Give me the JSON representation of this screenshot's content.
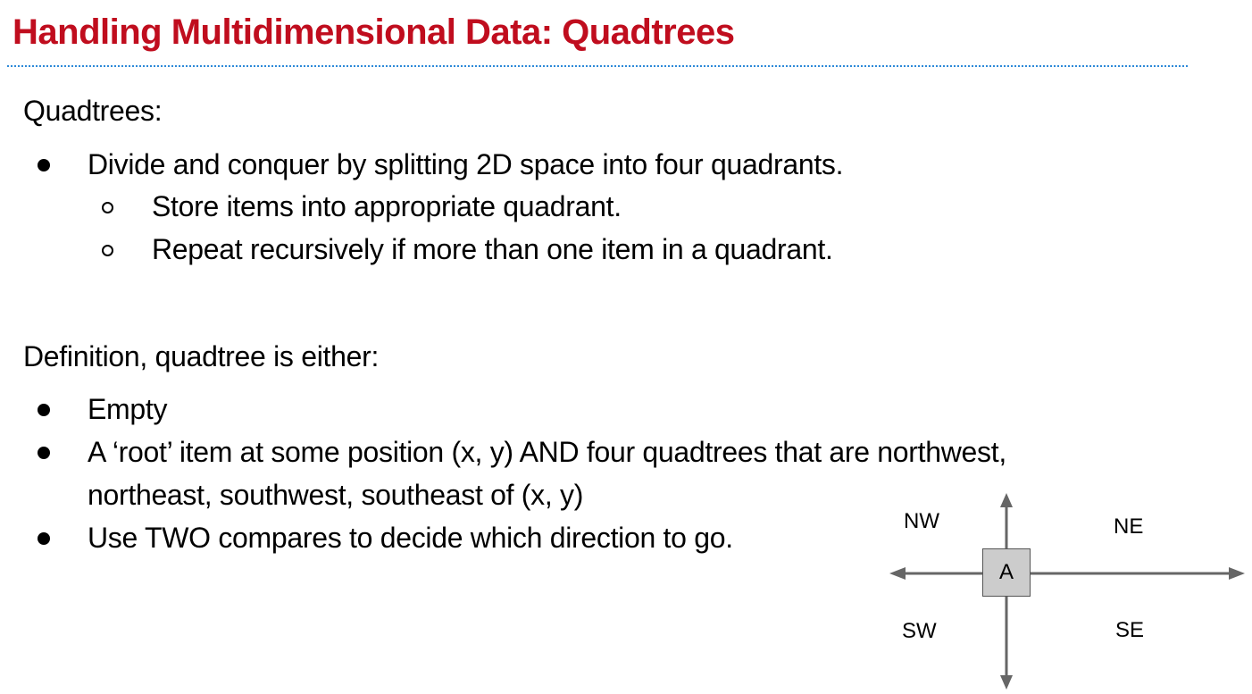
{
  "slide": {
    "title": "Handling Multidimensional Data: Quadtrees",
    "section1": {
      "heading": "Quadtrees:",
      "bullets": [
        "Divide and conquer by splitting 2D space into four quadrants."
      ],
      "sub_bullets": [
        "Store items into appropriate quadrant.",
        "Repeat recursively if more than one item in a quadrant."
      ]
    },
    "section2": {
      "heading": "Definition, quadtree is either:",
      "bullets": [
        "Empty",
        "A ‘root’ item at some position (x, y) AND four quadtrees that are northwest,",
        "Use TWO compares to decide which direction to go."
      ],
      "bullet2_continuation": "northeast, southwest, southeast of (x, y)"
    },
    "diagram": {
      "node_label": "A",
      "nw": "NW",
      "ne": "NE",
      "sw": "SW",
      "se": "SE"
    }
  },
  "colors": {
    "title": "#c00d1e",
    "rule": "#2e8ad8",
    "arrow": "#666666",
    "node_fill": "#cccccc"
  }
}
